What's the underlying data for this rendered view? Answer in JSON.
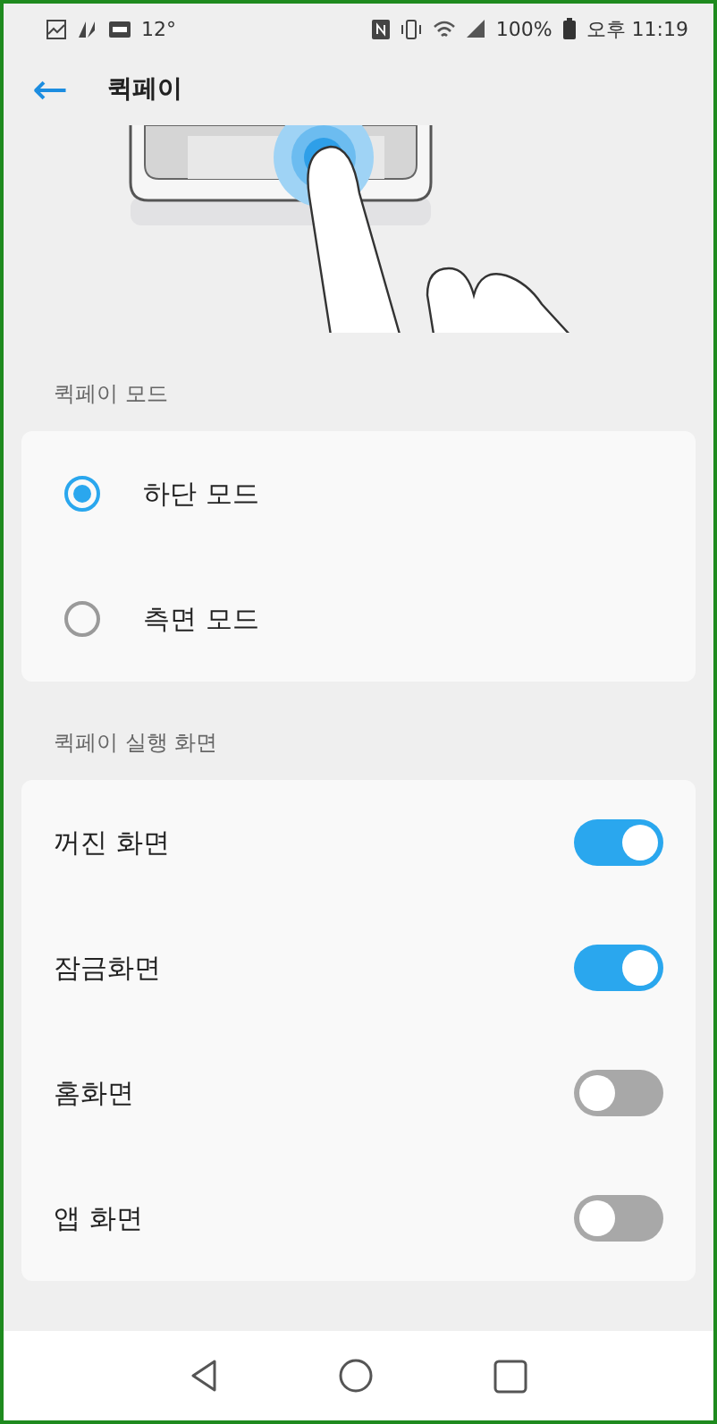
{
  "status_bar": {
    "temperature": "12°",
    "battery": "100%",
    "time": "오후 11:19"
  },
  "header": {
    "back": "←",
    "title": "퀵페이"
  },
  "sections": [
    {
      "title": "퀵페이 모드",
      "items": [
        {
          "kind": "radio",
          "label": "하단 모드",
          "selected": true
        },
        {
          "kind": "radio",
          "label": "측면 모드",
          "selected": false
        }
      ]
    },
    {
      "title": "퀵페이 실행 화면",
      "items": [
        {
          "kind": "toggle",
          "label": "꺼진 화면",
          "on": true
        },
        {
          "kind": "toggle",
          "label": "잠금화면",
          "on": true
        },
        {
          "kind": "toggle",
          "label": "홈화면",
          "on": false
        },
        {
          "kind": "toggle",
          "label": "앱 화면",
          "on": false
        }
      ]
    }
  ]
}
